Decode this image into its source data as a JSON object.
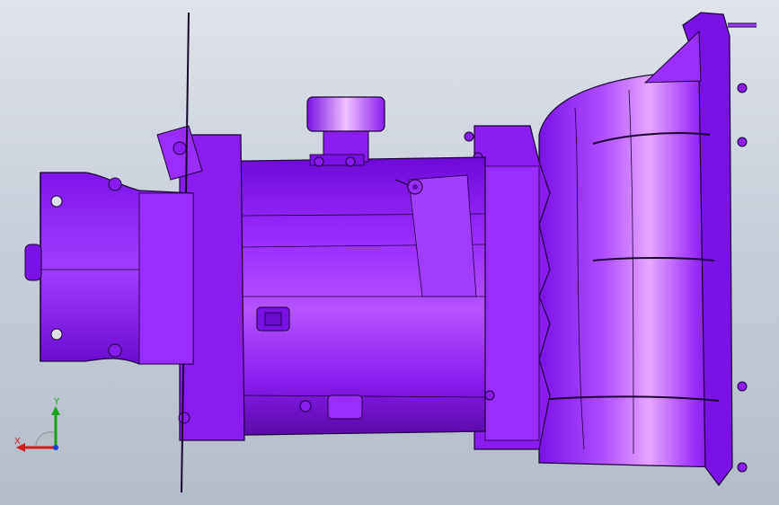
{
  "viewport": {
    "background_top": "#dfe3ea",
    "background_bottom": "#b3bcc9"
  },
  "model": {
    "part_color": "#8a1cf0",
    "edge_color": "#1a0533",
    "highlight_color": "#e39bff",
    "shade_color": "#5a0aa8"
  },
  "triad": {
    "x_label": "X",
    "y_label": "Y",
    "x_color": "#d01c1c",
    "y_color": "#1aa31a",
    "z_color": "#1c3fd0"
  }
}
